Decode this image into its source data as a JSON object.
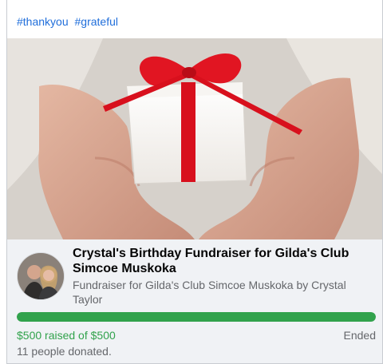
{
  "post": {
    "hashtags": [
      "#thankyou",
      "#grateful"
    ]
  },
  "fundraiser": {
    "title": "Crystal's Birthday Fundraiser for Gilda's Club Simcoe Muskoka",
    "subtitle": "Fundraiser for Gilda's Club Simcoe Muskoka by Crystal Taylor",
    "raised_text": "$500 raised of $500",
    "status": "Ended",
    "donors_text": "11 people donated.",
    "progress_fraction": 1.0
  },
  "colors": {
    "link": "#216fdb",
    "progress": "#31a24c",
    "ribbon": "#d8101d",
    "card_bg": "#f0f2f5"
  }
}
